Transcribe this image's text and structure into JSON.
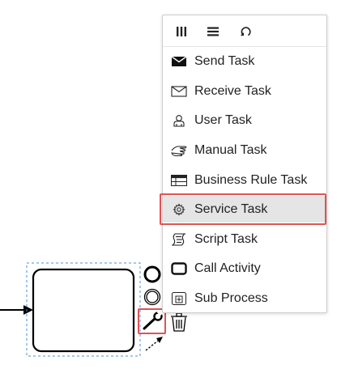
{
  "popup": {
    "header_buttons": [
      {
        "name": "toggle-columns-icon"
      },
      {
        "name": "hamburger-menu-icon"
      },
      {
        "name": "loop-icon"
      }
    ],
    "entries": [
      {
        "label": "Send Task",
        "icon": "send-envelope-icon"
      },
      {
        "label": "Receive Task",
        "icon": "receive-envelope-icon"
      },
      {
        "label": "User Task",
        "icon": "user-icon"
      },
      {
        "label": "Manual Task",
        "icon": "hand-icon"
      },
      {
        "label": "Business Rule Task",
        "icon": "table-icon"
      },
      {
        "label": "Service Task",
        "icon": "gear-icon",
        "selected": true
      },
      {
        "label": "Script Task",
        "icon": "script-icon"
      },
      {
        "label": "Call Activity",
        "icon": "call-activity-icon"
      },
      {
        "label": "Sub Process",
        "icon": "subprocess-icon"
      }
    ]
  },
  "context_pad": {
    "icons": [
      "end-event-icon",
      "intermediate-event-icon",
      "wrench-icon",
      "trash-icon",
      "connect-arrow-icon"
    ]
  },
  "colors": {
    "highlight": "#e05353",
    "selection": "#4a90d9",
    "selected_row": "#e5e5e5"
  }
}
